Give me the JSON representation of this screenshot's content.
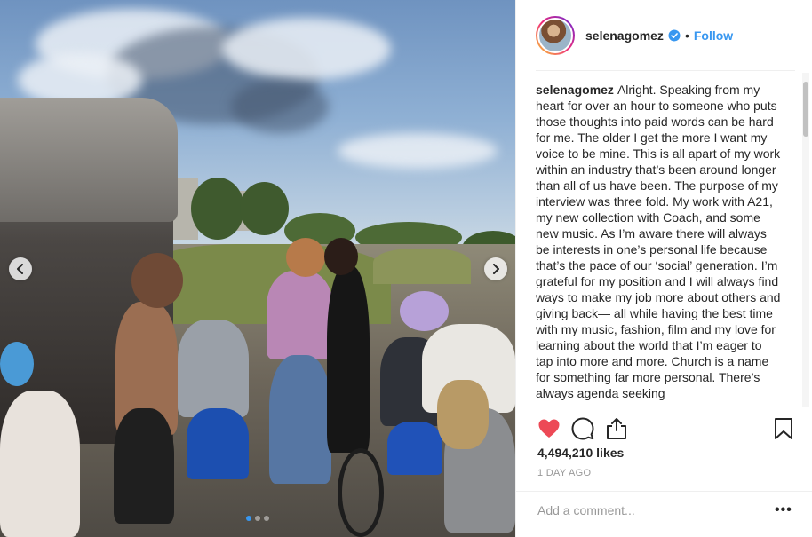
{
  "post": {
    "username": "selenagomez",
    "follow_label": "Follow",
    "separator": "•",
    "caption_user": "selenagomez",
    "caption_text": "Alright. Speaking from my heart for over an hour to someone who puts those thoughts into paid words can be hard for me. The older I get the more I want my voice to be mine. This is all apart of my work within an industry that’s been around longer than all of us have been. The purpose of my interview was three fold. My work with A21, my new collection with Coach, and some new music. As I’m aware there will always be interests in one’s personal life because that’s the pace of our ‘social’ generation. I’m grateful for my position and I will always find ways to make my job more about others and giving back— all while having the best time with my music, fashion, film and my love for learning about the world that I’m eager to tap into more and more. Church is a name for something far more personal. There’s always agenda seeking",
    "likes": "4,494,210 likes",
    "time_ago": "1 DAY AGO",
    "comment_placeholder": "Add a comment...",
    "more_label": "•••"
  },
  "carousel": {
    "total_slides": 3,
    "active_slide": 1
  },
  "icons": {
    "like": "heart-icon",
    "comment": "comment-icon",
    "share": "share-icon",
    "save": "bookmark-icon",
    "verified": "verified-badge-icon",
    "prev": "chevron-left-icon",
    "next": "chevron-right-icon"
  },
  "colors": {
    "link_blue": "#3897f0",
    "heart_red": "#ed4956",
    "muted_text": "#999999"
  }
}
